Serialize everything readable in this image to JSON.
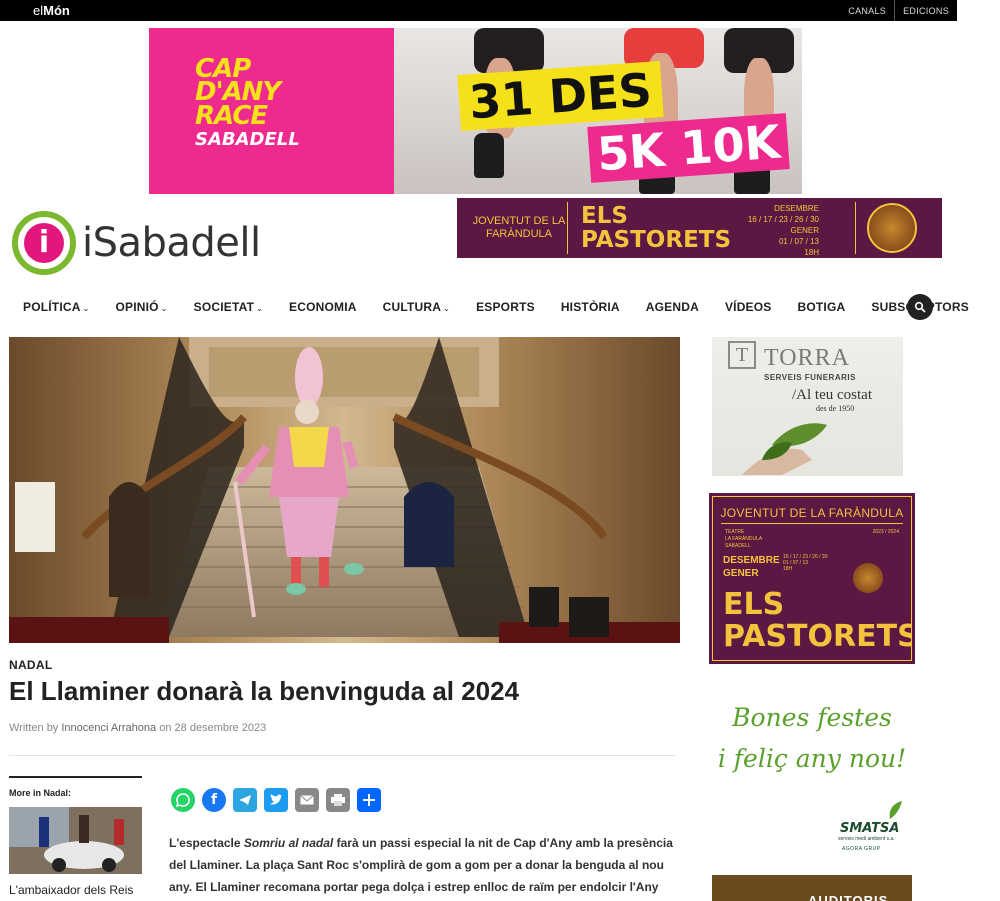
{
  "topbar": {
    "brand_prefix": "el",
    "brand_bold": "Món",
    "links": [
      "CANALS",
      "EDICIONS"
    ]
  },
  "race_ad": {
    "logo_line1": "CAP",
    "logo_line2": "D'ANY",
    "logo_line3": "RACE",
    "logo_line4": "SABADELL",
    "date": "31 DES",
    "distances": "5K 10K",
    "colors": {
      "pink": "#ee2a8e",
      "yellow": "#f5e11a"
    }
  },
  "site": {
    "logo_letter": "i",
    "name": "iSabadell"
  },
  "pastorets_banner": {
    "org": "JOVENTUT DE LA FARÀNDULA",
    "title_line1": "ELS",
    "title_line2": "PASTORETS",
    "dates_line1": "DESEMBRE",
    "dates_line2": "16 / 17 / 23 / 26 / 30",
    "dates_line3": "GENER",
    "dates_line4": "01 / 07 / 13",
    "dates_line5": "18H",
    "colors": {
      "background": "#5a1843",
      "text": "#f4c33d"
    }
  },
  "nav": {
    "items": [
      {
        "label": "POLÍTICA",
        "dropdown": true
      },
      {
        "label": "OPINIÓ",
        "dropdown": true
      },
      {
        "label": "SOCIETAT",
        "dropdown": true
      },
      {
        "label": "ECONOMIA",
        "dropdown": false
      },
      {
        "label": "CULTURA",
        "dropdown": true
      },
      {
        "label": "ESPORTS",
        "dropdown": false
      },
      {
        "label": "HISTÒRIA",
        "dropdown": false
      },
      {
        "label": "AGENDA",
        "dropdown": false
      },
      {
        "label": "VÍDEOS",
        "dropdown": false
      },
      {
        "label": "BOTIGA",
        "dropdown": false
      },
      {
        "label": "SUBSCRIPTORS",
        "dropdown": false
      }
    ],
    "search_icon": "search-icon"
  },
  "article": {
    "kicker": "NADAL",
    "headline": "El Llaminer donarà la benvinguda al 2024",
    "byline_written": "Written by",
    "byline_author": "Innocenci Arrahona",
    "byline_on": "on",
    "byline_date": "28 desembre 2023",
    "body_prefix": "L'espectacle ",
    "body_italic": "Somriu al nadal",
    "body_rest": " farà un passi especial la nit de Cap d'Any amb la presència del Llaminer. La plaça Sant Roc s'omplirà de gom a gom per a donar la benguda al nou any. El Llaminer recomana portar pega dolça i estrep enlloc de raïm per endolcir l'Any Nou."
  },
  "more_in": {
    "label": "More in Nadal:",
    "item_caption": "L'ambaixador dels Reis"
  },
  "share": {
    "icons": [
      {
        "name": "whatsapp-icon",
        "color": "#25d366"
      },
      {
        "name": "facebook-icon",
        "color": "#1877f2"
      },
      {
        "name": "telegram-icon",
        "color": "#2ca5e0"
      },
      {
        "name": "twitter-icon",
        "color": "#1d9bf0"
      },
      {
        "name": "email-icon",
        "color": "#888888"
      },
      {
        "name": "print-icon",
        "color": "#888888"
      },
      {
        "name": "share-icon",
        "color": "#0166ff"
      }
    ]
  },
  "sidebar": {
    "torra": {
      "monogram": "T",
      "name": "TORRA",
      "sub": "SERVEIS FUNERARIS",
      "slogan": "/Al teu costat",
      "since": "des de 1950"
    },
    "pastorets": {
      "org": "JOVENTUT DE LA FARÀNDULA",
      "small1": "TEATRE",
      "small2": "LA FARÀNDULA",
      "small3": "SABADELL",
      "year": "2023 / 2024",
      "month1": "DESEMBRE",
      "month1_days": "16 / 17 / 23 / 26 / 30",
      "month2": "GENER",
      "month2_days": "01 / 07 / 13",
      "hour": "18H",
      "title_line1": "ELS",
      "title_line2": "PASTORETS"
    },
    "smatsa": {
      "line1": "Bones festes",
      "line2": "i feliç any nou!",
      "logo": "SMATSA",
      "sub1": "serveis medi ambient s.a.",
      "sub2": "AGORA GRUP"
    },
    "auditoris": {
      "label": "AUDITORIS"
    }
  }
}
